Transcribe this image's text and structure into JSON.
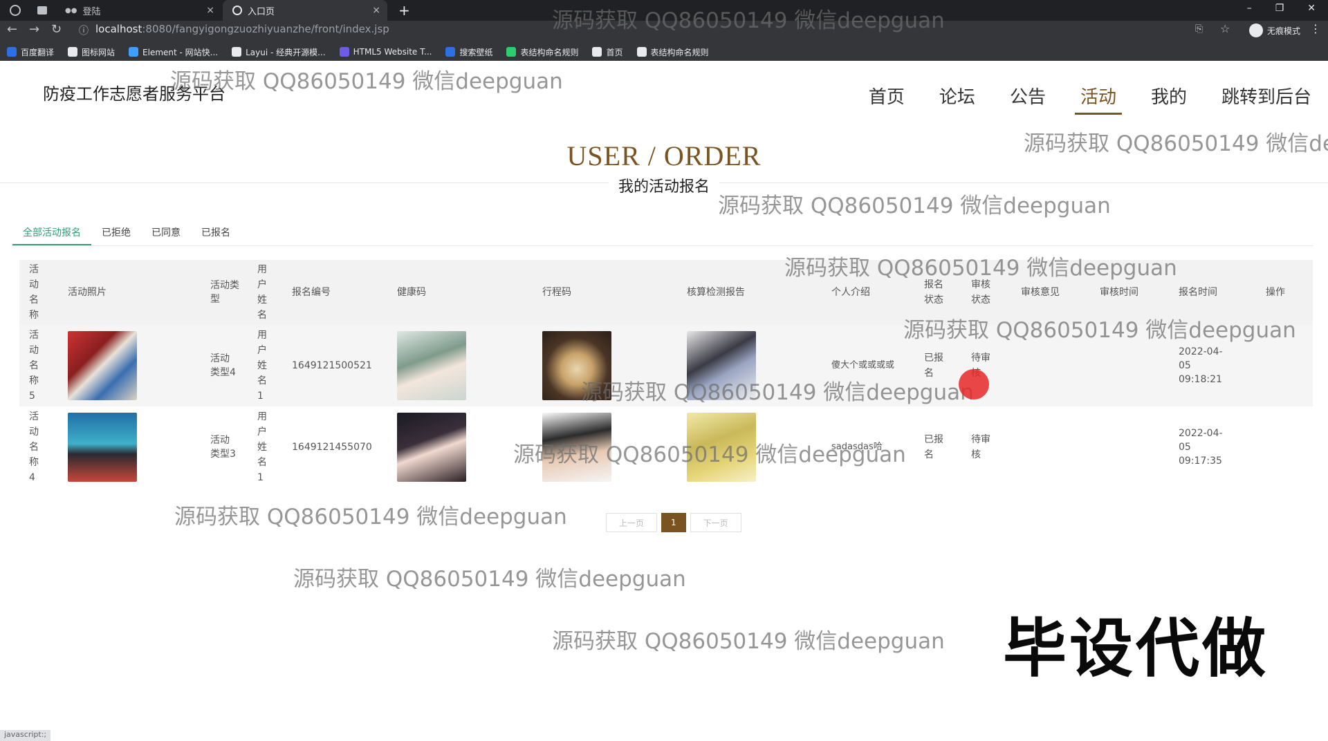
{
  "browser": {
    "tabs": [
      {
        "label": "登陆",
        "close": "×"
      },
      {
        "label": "入口页",
        "close": "×"
      }
    ],
    "new_tab": "+",
    "url_host": "localhost",
    "url_rest": ":8080/fangyigongzuozhiyuanzhe/front/index.jsp",
    "bookmarks": [
      {
        "label": "百度翻译",
        "color": "#2f6fe4"
      },
      {
        "label": "图标网站",
        "color": "#e8eaed"
      },
      {
        "label": "Element - 网站快...",
        "color": "#409eff"
      },
      {
        "label": "Layui - 经典开源模...",
        "color": "#e8eaed"
      },
      {
        "label": "HTML5 Website T...",
        "color": "#6c5ce7"
      },
      {
        "label": "搜索壁纸",
        "color": "#2f6fe4"
      },
      {
        "label": "表结构命名规则",
        "color": "#2ecc71"
      },
      {
        "label": "首页",
        "color": "#e8eaed"
      },
      {
        "label": "表结构命名规则",
        "color": "#e8eaed"
      }
    ],
    "incognito": "无痕模式",
    "window_controls": [
      "–",
      "❐",
      "✕"
    ]
  },
  "site": {
    "title": "防疫工作志愿者服务平台",
    "nav": [
      "首页",
      "论坛",
      "公告",
      "活动",
      "我的",
      "跳转到后台"
    ],
    "active_nav": "活动"
  },
  "hero": {
    "title_en": "USER / ORDER",
    "title_cn": "我的活动报名"
  },
  "tabs": [
    "全部活动报名",
    "已拒绝",
    "已同意",
    "已报名"
  ],
  "table": {
    "headers": [
      "活动名称",
      "活动照片",
      "活动类型",
      "用户姓名",
      "报名编号",
      "健康码",
      "行程码",
      "核算检测报告",
      "个人介绍",
      "报名状态",
      "审核状态",
      "审核意见",
      "审核时间",
      "报名时间",
      "操作"
    ],
    "rows": [
      {
        "name": "活动名称5",
        "photo": "activity-photo",
        "type": "活动类型4",
        "user": "用户姓名1",
        "number": "1649121500521",
        "health": "health-code-photo",
        "trip": "trip-code-photo",
        "report": "test-report-photo",
        "intro": "傻大个或或或或",
        "status": "已报名",
        "audit": "待审核",
        "opinion": "",
        "audit_time": "",
        "time": "2022-04-05 09:18:21"
      },
      {
        "name": "活动名称4",
        "photo": "activity-photo",
        "type": "活动类型3",
        "user": "用户姓名1",
        "number": "1649121455070",
        "health": "health-code-photo",
        "trip": "trip-code-photo",
        "report": "test-report-photo",
        "intro": "sadasdas哈",
        "status": "已报名",
        "audit": "待审核",
        "opinion": "",
        "audit_time": "",
        "time": "2022-04-05 09:17:35"
      }
    ]
  },
  "pager": {
    "prev": "上一页",
    "current": "1",
    "next": "下一页"
  },
  "watermark": "源码获取 QQ86050149 微信deepguan",
  "watermark_cut": "源码获取 QQ86050149 微信dee",
  "promo": "毕设代做",
  "status": "javascript:;"
}
